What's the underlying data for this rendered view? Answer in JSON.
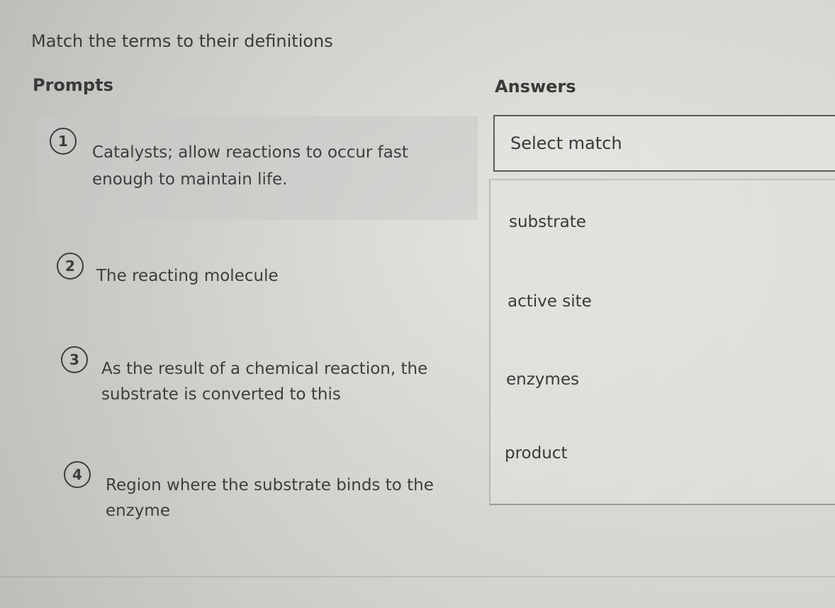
{
  "instruction": "Match the terms to their definitions",
  "headers": {
    "prompts": "Prompts",
    "answers": "Answers"
  },
  "prompts": [
    {
      "number": "1",
      "text": "Catalysts; allow reactions to occur fast enough to maintain life."
    },
    {
      "number": "2",
      "text": "The reacting molecule"
    },
    {
      "number": "3",
      "text": "As the result of a chemical reaction, the substrate is converted to this"
    },
    {
      "number": "4",
      "text": "Region where the substrate binds to the enzyme"
    }
  ],
  "answer_select": {
    "label": "Select match"
  },
  "answer_options": [
    {
      "label": "substrate"
    },
    {
      "label": "active site"
    },
    {
      "label": "enzymes"
    },
    {
      "label": "product"
    }
  ]
}
